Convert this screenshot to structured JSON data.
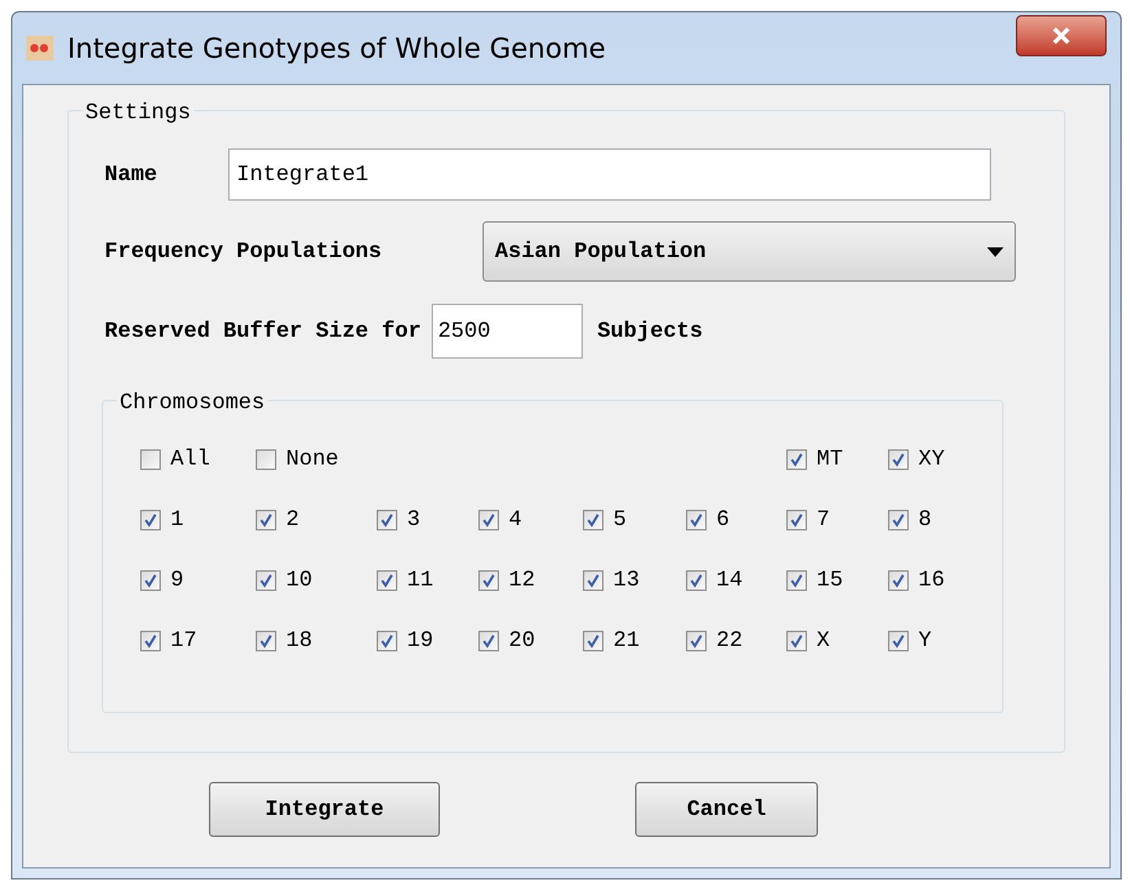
{
  "window": {
    "title": "Integrate Genotypes of Whole Genome"
  },
  "settings": {
    "title": "Settings",
    "name": {
      "label": "Name",
      "value": "Integrate1"
    },
    "frequency": {
      "label": "Frequency Populations",
      "value": "Asian Population"
    },
    "buffer": {
      "label_before": "Reserved Buffer Size for",
      "value": "2500",
      "label_after": "Subjects"
    }
  },
  "chromosomes": {
    "title": "Chromosomes",
    "quick": [
      {
        "label": "All",
        "checked": false
      },
      {
        "label": "None",
        "checked": false
      },
      {
        "label": "MT",
        "checked": true
      },
      {
        "label": "XY",
        "checked": true
      }
    ],
    "items": [
      {
        "label": "1",
        "checked": true
      },
      {
        "label": "2",
        "checked": true
      },
      {
        "label": "3",
        "checked": true
      },
      {
        "label": "4",
        "checked": true
      },
      {
        "label": "5",
        "checked": true
      },
      {
        "label": "6",
        "checked": true
      },
      {
        "label": "7",
        "checked": true
      },
      {
        "label": "8",
        "checked": true
      },
      {
        "label": "9",
        "checked": true
      },
      {
        "label": "10",
        "checked": true
      },
      {
        "label": "11",
        "checked": true
      },
      {
        "label": "12",
        "checked": true
      },
      {
        "label": "13",
        "checked": true
      },
      {
        "label": "14",
        "checked": true
      },
      {
        "label": "15",
        "checked": true
      },
      {
        "label": "16",
        "checked": true
      },
      {
        "label": "17",
        "checked": true
      },
      {
        "label": "18",
        "checked": true
      },
      {
        "label": "19",
        "checked": true
      },
      {
        "label": "20",
        "checked": true
      },
      {
        "label": "21",
        "checked": true
      },
      {
        "label": "22",
        "checked": true
      },
      {
        "label": "X",
        "checked": true
      },
      {
        "label": "Y",
        "checked": true
      }
    ]
  },
  "buttons": [
    "Integrate",
    "Cancel"
  ]
}
